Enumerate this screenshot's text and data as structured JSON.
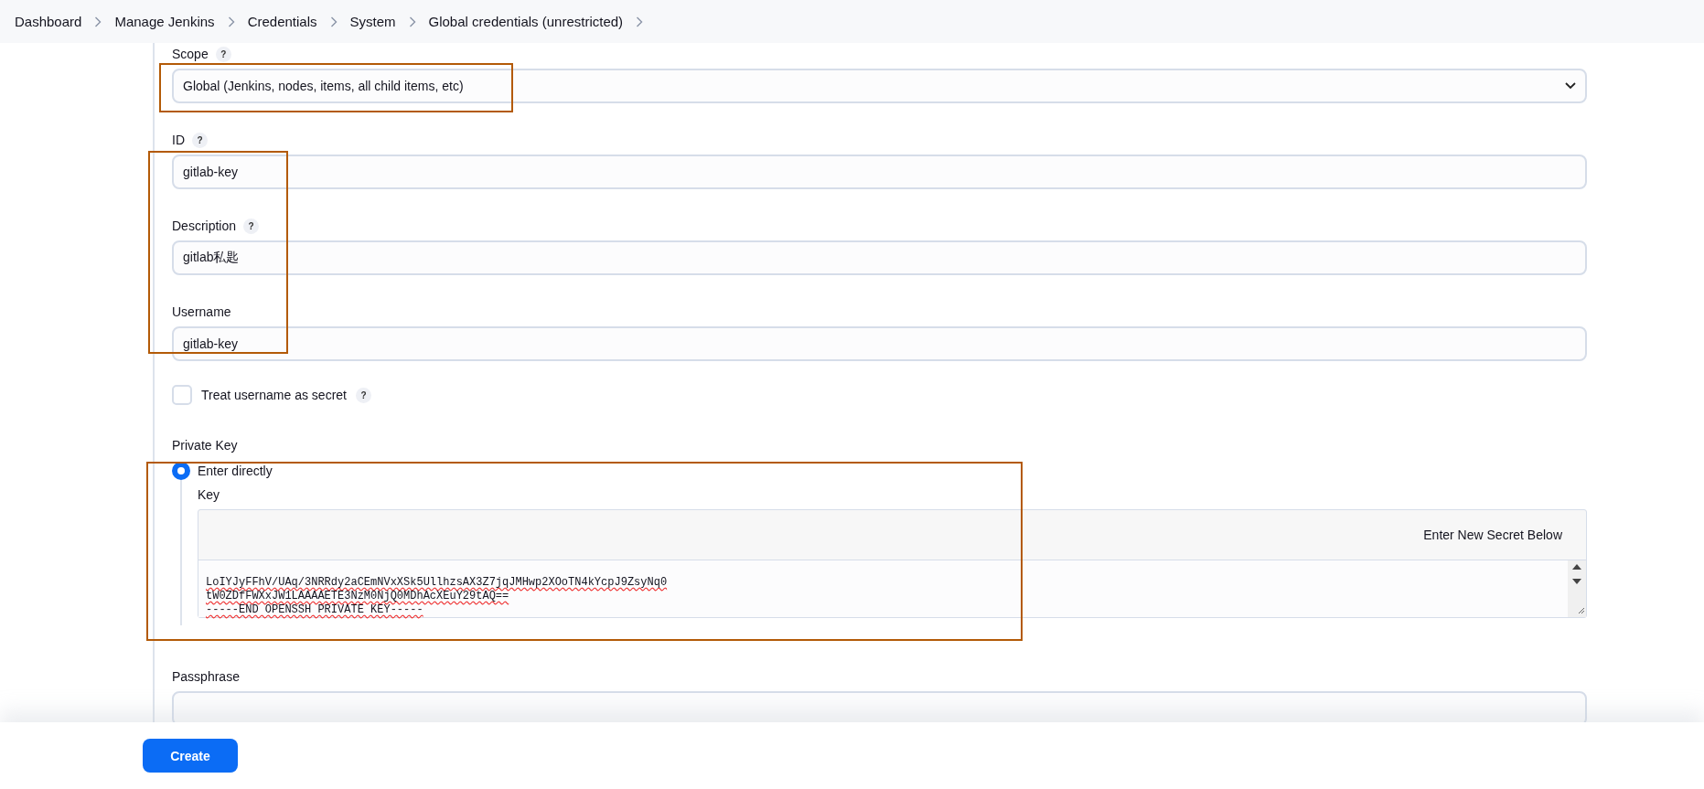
{
  "breadcrumb": [
    "Dashboard",
    "Manage Jenkins",
    "Credentials",
    "System",
    "Global credentials (unrestricted)"
  ],
  "fields": [
    {
      "kind": "select",
      "label": "Scope",
      "help": "?",
      "value": "Global (Jenkins, nodes, items, all child items, etc)"
    },
    {
      "kind": "text",
      "label": "ID",
      "help": "?",
      "value": "gitlab-key"
    },
    {
      "kind": "text",
      "label": "Description",
      "help": "?",
      "value": "gitlab私匙"
    },
    {
      "kind": "text",
      "label": "Username",
      "value": "gitlab-key"
    },
    {
      "kind": "checkbox",
      "label": "Treat username as secret",
      "help": "?",
      "checked": false
    }
  ],
  "private_key": {
    "label": "Private Key",
    "options": [
      {
        "label": "Enter directly",
        "selected": true
      }
    ],
    "key_label": "Key",
    "secret_hint": "Enter New Secret Below",
    "key_lines": [
      "LoIYJyFFhV/UAq/3NRRdy2aCEmNVxXSk5UllhzsAX3Z7jqJMHwp2XOoTN4kYcpJ9ZsyNq0",
      "tW0ZDfFWXxJW1LAAAAETE3NzM0NjQ0MDhAcXEuY29tAQ==",
      "-----END OPENSSH PRIVATE KEY-----"
    ]
  },
  "passphrase": {
    "label": "Passphrase"
  },
  "create_button": "Create"
}
